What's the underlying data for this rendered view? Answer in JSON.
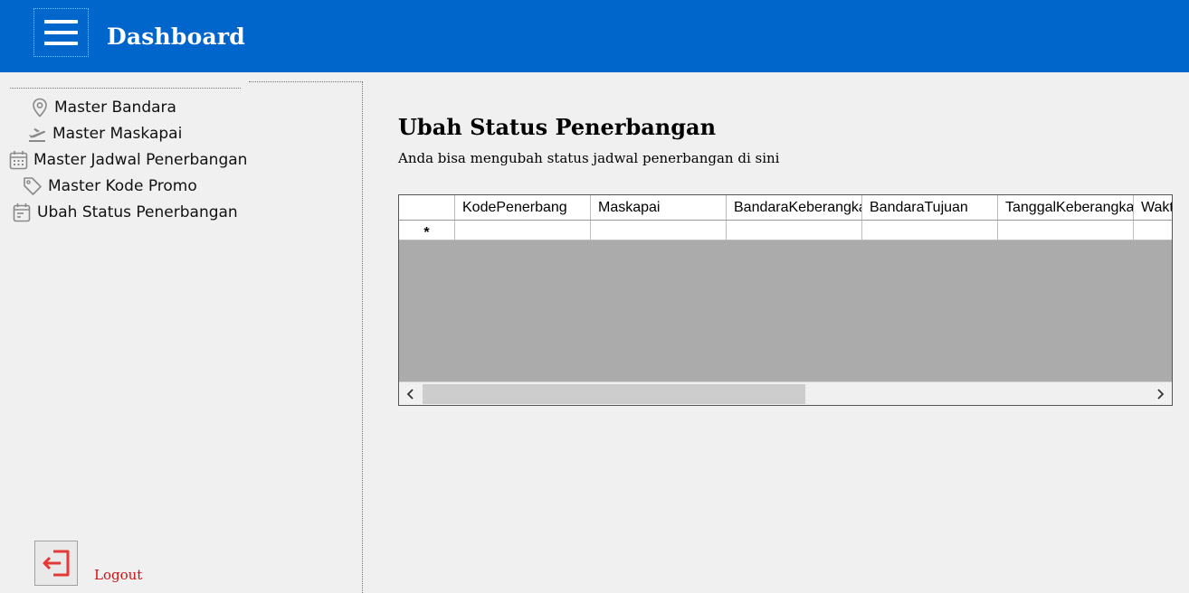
{
  "header": {
    "title": "Dashboard",
    "menu_icon": "hamburger-icon",
    "background_color": "#0066cc"
  },
  "sidebar": {
    "items": [
      {
        "label": "Master Bandara",
        "icon": "map-pin-icon"
      },
      {
        "label": "Master Maskapai",
        "icon": "airplane-takeoff-icon"
      },
      {
        "label": "Master Jadwal Penerbangan",
        "icon": "calendar-icon"
      },
      {
        "label": "Master Kode Promo",
        "icon": "tag-icon"
      },
      {
        "label": "Ubah Status Penerbangan",
        "icon": "calendar-event-icon"
      }
    ],
    "logout": {
      "label": "Logout",
      "icon": "logout-icon",
      "color": "#d01010"
    }
  },
  "main": {
    "title": "Ubah Status Penerbangan",
    "subtitle": "Anda bisa mengubah status jadwal penerbangan di sini",
    "grid": {
      "columns": [
        "KodePenerbang",
        "Maskapai",
        "BandaraKeberangkatan",
        "BandaraTujuan",
        "TanggalKeberangkatan",
        "Waktu"
      ],
      "new_row_marker": "*",
      "rows": []
    }
  }
}
